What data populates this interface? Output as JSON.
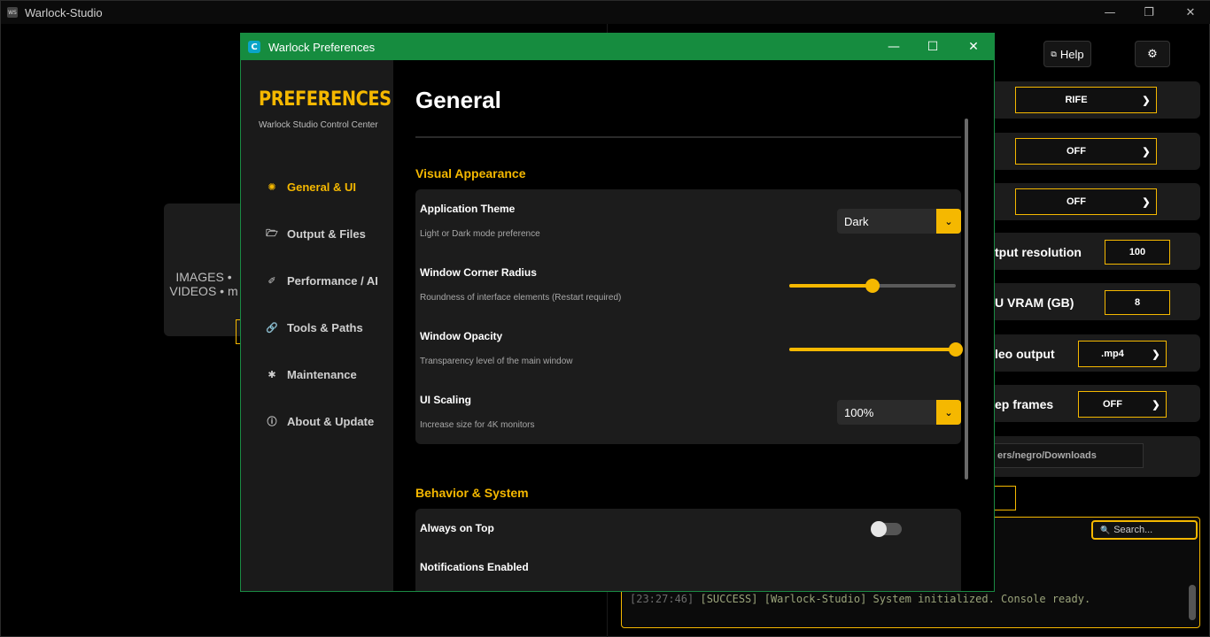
{
  "main_window": {
    "title": "Warlock-Studio",
    "app_icon_text": "WS",
    "controls": {
      "minimize": "—",
      "maximize": "❐",
      "close": "✕"
    }
  },
  "background": {
    "drop_text_line1": "IMAGES •",
    "drop_text_line2": "VIDEOS • m",
    "help_label": "Help",
    "rows": [
      {
        "label": "",
        "value": "RIFE"
      },
      {
        "label": "",
        "value": "OFF"
      },
      {
        "label": "",
        "value": "OFF"
      },
      {
        "label": "tput resolution",
        "value": "100"
      },
      {
        "label": "U VRAM (GB)",
        "value": "8"
      },
      {
        "label": "leo output",
        "value": ".mp4"
      },
      {
        "label": "ep frames",
        "value": "OFF"
      }
    ],
    "output_path": "ers/negro/Downloads",
    "console_search_placeholder": "Search...",
    "console_line_ts": "[23:27:46]",
    "console_line_text": " [SUCCESS] [Warlock-Studio] System initialized. Console ready."
  },
  "dialog": {
    "title": "Warlock Preferences",
    "icon_letter": "C",
    "controls": {
      "minimize": "—",
      "maximize": "☐",
      "close": "✕"
    },
    "sidebar": {
      "brand": "PREFERENCES",
      "subtitle": "Warlock Studio Control Center",
      "items": [
        {
          "label": "General & UI",
          "icon": "✺",
          "active": true
        },
        {
          "label": "Output & Files",
          "icon": "🗁"
        },
        {
          "label": "Performance / AI",
          "icon": "✐"
        },
        {
          "label": "Tools & Paths",
          "icon": "🔗"
        },
        {
          "label": "Maintenance",
          "icon": "✱"
        },
        {
          "label": "About & Update",
          "icon": "ⓘ"
        }
      ]
    },
    "content": {
      "page_title": "General",
      "sections": {
        "visual": "Visual Appearance",
        "behavior": "Behavior & System"
      },
      "options": {
        "theme": {
          "label": "Application Theme",
          "desc": "Light or Dark mode preference",
          "value": "Dark"
        },
        "corner_radius": {
          "label": "Window Corner Radius",
          "desc": "Roundness of interface elements (Restart required)",
          "level": 0.5
        },
        "opacity": {
          "label": "Window Opacity",
          "desc": "Transparency level of the main window",
          "level": 1.0
        },
        "scaling": {
          "label": "UI Scaling",
          "desc": "Increase size for 4K monitors",
          "value": "100%"
        },
        "always_on_top": {
          "label": "Always on Top",
          "enabled": false
        },
        "notifications": {
          "label": "Notifications Enabled"
        }
      }
    }
  },
  "colors": {
    "accent": "#f5b800",
    "titlebar_green": "#168c3f",
    "panel": "#1c1c1c"
  }
}
